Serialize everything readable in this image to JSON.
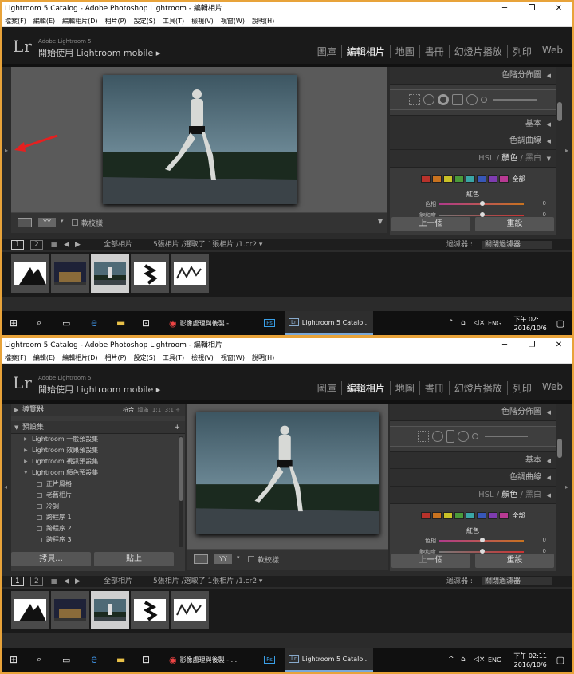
{
  "window": {
    "title": "Lightroom 5 Catalog - Adobe Photoshop Lightroom - 編輯相片",
    "min": "─",
    "max": "❐",
    "close": "✕"
  },
  "menu": [
    "檔案(F)",
    "編輯(E)",
    "編輯相片(D)",
    "相片(P)",
    "設定(S)",
    "工具(T)",
    "檢視(V)",
    "視窗(W)",
    "說明(H)"
  ],
  "identity": {
    "logo": "Lr",
    "product": "Adobe Lightroom 5",
    "mobile": "開始使用 Lightroom mobile ▸"
  },
  "modules": [
    "圖庫",
    "編輯相片",
    "地圖",
    "書冊",
    "幻燈片播放",
    "列印",
    "Web"
  ],
  "right": {
    "histogram": "色階分佈圖",
    "basic": "基本",
    "tonecurve": "色調曲線",
    "hsl": "HSL",
    "color": "顏色",
    "bw": "黑白",
    "all": "全部",
    "red": "紅色",
    "hue": "色相",
    "sat": "飽和度",
    "hue_val": "0",
    "sat_val": "0",
    "prev": "上一個",
    "reset": "重設"
  },
  "toolbar": {
    "softproof": "軟校樣",
    "yy": "YY"
  },
  "filmnav": {
    "p1": "1",
    "p2": "2",
    "all": "全部相片",
    "info": "5張相片 /選取了 1張相片 /1.cr2 ▾",
    "filter": "過濾器 :",
    "filter_val": "關閉過濾器"
  },
  "left": {
    "navigator": "導覽器",
    "fit": "符合",
    "fill": "填滿",
    "r1": "1:1",
    "r2": "3:1 ÷",
    "presets": "預設集",
    "add": "+",
    "groups": [
      "Lightroom 一般預設集",
      "Lightroom 效果預設集",
      "Lightroom 視訊預設集",
      "Lightroom 顏色預設集"
    ],
    "items": [
      "正片風格",
      "老舊相片",
      "冷調",
      "跨程序 1",
      "跨程序 2",
      "跨程序 3"
    ],
    "copy": "拷貝...",
    "paste": "貼上"
  },
  "taskbar": {
    "chrome": "影像處理與後製 - ...",
    "lr": "Lightroom 5 Catalo...",
    "lang": "ENG",
    "time": "下午 02:11",
    "date": "2016/10/6"
  },
  "colors": {
    "accent": "#e8a33a",
    "panel": "#3a3a3a",
    "work": "#5a5a5a"
  }
}
